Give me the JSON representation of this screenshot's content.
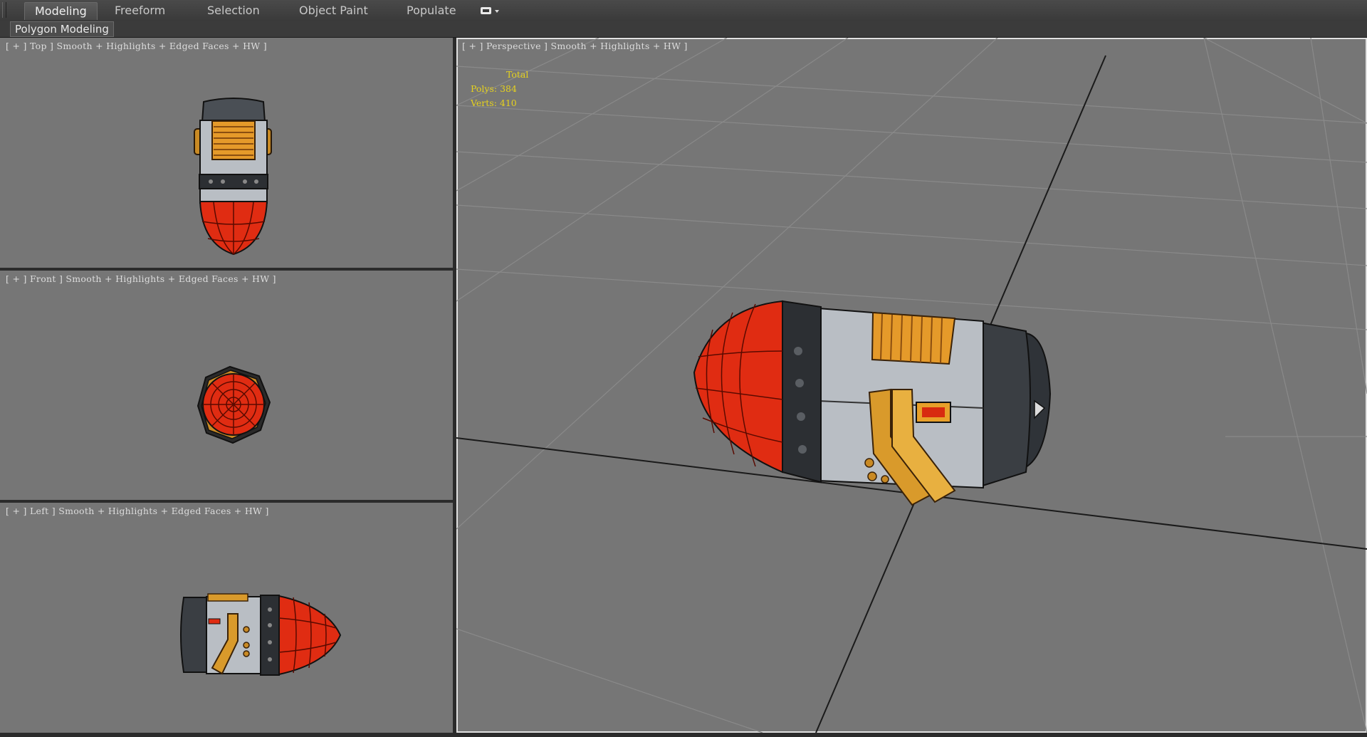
{
  "ribbon": {
    "tabs": [
      "Modeling",
      "Freeform",
      "Selection",
      "Object Paint",
      "Populate"
    ],
    "active_tab": "Modeling",
    "dropdown_icon": "display-toggle-icon"
  },
  "subbar": {
    "panel_label": "Polygon Modeling"
  },
  "viewports": {
    "top": {
      "label": "[ + ] Top ] Smooth + Highlights + Edged Faces + HW ]"
    },
    "front": {
      "label": "[ + ] Front ] Smooth + Highlights + Edged Faces + HW ]"
    },
    "left": {
      "label": "[ + ] Left ] Smooth + Highlights + Edged Faces + HW ]"
    },
    "perspective": {
      "label": "[ + ] Perspective ] Smooth + Highlights + HW ]"
    }
  },
  "stats": {
    "header": "Total",
    "polys": "Polys: 384",
    "verts": "Verts: 410"
  },
  "colors": {
    "viewport_bg": "#767676",
    "active_border": "#e0e0e0",
    "stats_text": "#e6d21e",
    "rocket_red": "#e02c12",
    "rocket_metal": "#b9bec4",
    "rocket_gold": "#d99a2b"
  }
}
